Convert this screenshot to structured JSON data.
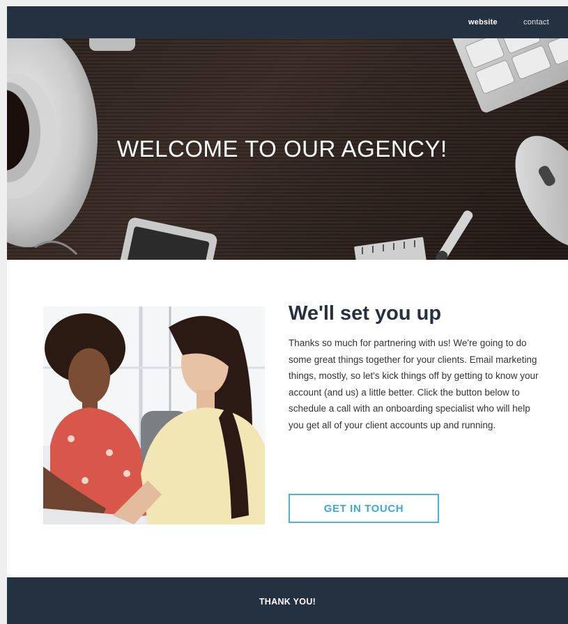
{
  "nav": {
    "links": [
      {
        "label": "website"
      },
      {
        "label": "contact"
      }
    ]
  },
  "hero": {
    "title": "WELCOME TO OUR AGENCY!",
    "image_icon": "desk-workspace-photo"
  },
  "feature": {
    "image_icon": "two-women-working-photo",
    "heading": "We'll set you up",
    "body": "Thanks so much for partnering with us! We're going to do some great things together for your clients. Email marketing things, mostly, so let's kick things off by getting to know your account (and us) a little better. Click the button below to schedule a call with an onboarding specialist who will help you get all of your client accounts up and running.",
    "cta_label": "GET IN TOUCH"
  },
  "footer": {
    "text": "THANK YOU!"
  },
  "colors": {
    "navy": "#243140",
    "accent": "#47b2e6",
    "background": "#efefef"
  }
}
